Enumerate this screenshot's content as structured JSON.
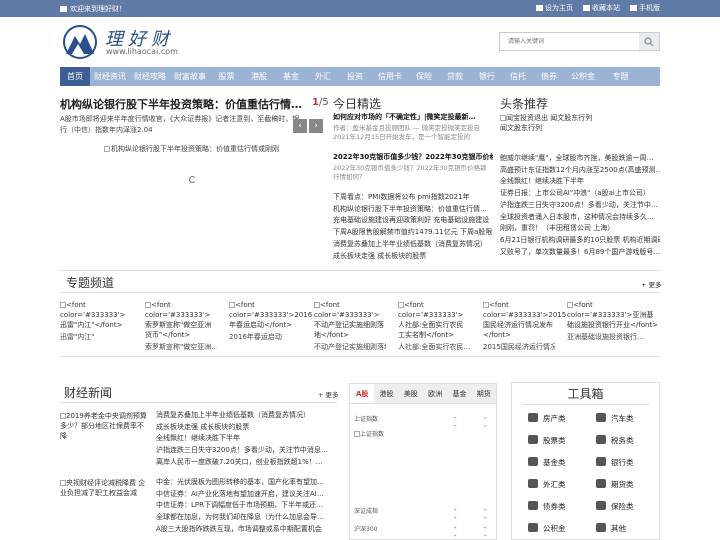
{
  "topbar": {
    "welcome": "欢迎来到理好财！",
    "links": [
      "设为主页",
      "收藏本站",
      "手机版"
    ]
  },
  "logo": {
    "name": "理好财",
    "url": "www.lihaocai.com"
  },
  "search": {
    "placeholder": "请输入关键词"
  },
  "nav": [
    "首页",
    "财经资讯",
    "财经攻略",
    "财富故事",
    "股票",
    "港股",
    "基金",
    "外汇",
    "投资",
    "信用卡",
    "保险",
    "贷款",
    "银行",
    "信托",
    "债券",
    "公积金",
    "专题"
  ],
  "slider": {
    "title": "机构纵论银行股下半年投资策略：价值重估行情或刚刚开启",
    "page": "1",
    "total": "/5",
    "desc": "A股市场即将迎来半年度行情收官，《大众证券报》记者注意到，至截稿时，银行（中信）指数年内㴖涨2.04",
    "img_alt": "机构纵论银行股下半年投资策略：价值重估行情或刚刚"
  },
  "today": {
    "title": "今日精选",
    "items": [
      {
        "title": "如何应对市场的「不确定性」|微笑定投最新…",
        "desc": "作者：盈米基金且投顾团队 — 微笑定投微笑定投自2021年12月15日开始发车，是一个智能定投的"
      },
      {
        "title": "2022年30克银币值多少钱？2022年30克银币价格…",
        "desc": "2022年30克银币值多少钱？2022年30克银币价格颍行情如何？"
      }
    ],
    "list": [
      "下周看点：PMI数据将公布 pmi指数2021年",
      "机构纵论银行股下半年投资策略：价值重估行情…",
      "充电基础设施建设再迎政策利好 充电基础设施建设",
      "下周A股限售股解禁市值约1479.11亿元 下周a股限售",
      "消费复苏叠加上半年业绩低基数（消费复苏情况）",
      "成长板块走强 成长板块的股票"
    ]
  },
  "headlines": {
    "title": "头条推荐",
    "img_alt": "闻宝投资退出 闻文股东行列",
    "cap": "闻文股东行列",
    "list": [
      "鲍威尔继续\"鹰\"，全球股市齐挫，美股跌逾一周…",
      "高盛预计东证指数12个月内涨至2500点(高盛预测…",
      "全线飘红！继续决胜下半年",
      "证券日报：上市公司AI\"冲浪\"（a股ai上市公司）",
      "沪指连跌三日失守3200点！多看少动，关注节中…",
      "全球投资者涌入日本股市，这种情况会持续多久…",
      "刚刚，重罚！（丰田租赁公司 上海）",
      "6月21日银行机构调研最多的10只股票 机构近期调研最",
      "又败号了，单次数量最多！6月89个国产游戏版号…"
    ]
  },
  "topics": {
    "title": "专题频道",
    "more": "+ 更多",
    "items": [
      {
        "alt": "<font color='#333333'>迅雷\"内江\"</font>",
        "cap": "迅雷\"内江\""
      },
      {
        "alt": "<font color='#333333'>索罗斯宣称\"做空亚洲货币\"</font>",
        "cap": "索罗斯宣称\"做空亚洲…"
      },
      {
        "alt": "<font color='#333333'>2016年春运启动</font>",
        "cap": "2016年春运启动"
      },
      {
        "alt": "<font color='#333333'>不动产登记实施细则落地</font>",
        "cap": "不动产登记实施细则落地"
      },
      {
        "alt": "<font color='#333333'>人社部:全面实行农民工实名制</font>",
        "cap": "人社部:全面实行农民…"
      },
      {
        "alt": "<font color='#333333'>2015国民经济运行情况发布</font>",
        "cap": "2015国民经济运行情况…"
      },
      {
        "alt": "<font color='#333333'>亚洲基础设施投资银行开业</font>",
        "cap": "亚洲基础设施投资银行…"
      }
    ]
  },
  "news": {
    "title": "财经新闻",
    "more": "+ 更多",
    "thumbs": [
      "2019养老金中央调剂预算多少？部分地区社保费率不降",
      "央视财经评论减税降费 企业负担减了职工权益会减"
    ],
    "list1": [
      "消费复苏叠加上半年业绩低基数（消费复苏情况）",
      "成长板块走强 成长板块的股票",
      "全线飘红！继续决胜下半年",
      "沪指连跌三日失守3200点！多看少动，关注节中消息…",
      "离岸人民币一度跌破7.20关口，创业板指跌超1%！…"
    ],
    "list2": [
      "中金：光伏膜板为图形转移的基本，国产化率有望加…",
      "中信证券：AI产业化落地有望加速开启，建议关注AI…",
      "中信证券：LPR下调幅度低于市场预期，下半年或还…",
      "全球都在加息，为何我们却在降息（为什么加息会导…",
      "A股三大股指昨跌跌互现，市场调整或系中期配置机会"
    ]
  },
  "market": {
    "tabs": [
      "A股",
      "港股",
      "美股",
      "欧洲",
      "基金",
      "期货"
    ],
    "rows": [
      {
        "name": "上证指数",
        "v1": "--",
        "v2": "--"
      },
      {
        "name": "深证成指",
        "v1": "--",
        "v2": "--"
      },
      {
        "name": "沪深300",
        "v1": "--",
        "v2": "--"
      }
    ],
    "img_alt": "上证指数"
  },
  "tools": {
    "title": "工具箱",
    "items": [
      "房产类",
      "汽车类",
      "股票类",
      "税务类",
      "基金类",
      "银行类",
      "外汇类",
      "期货类",
      "债券类",
      "保险类",
      "公积金",
      "其他"
    ]
  }
}
